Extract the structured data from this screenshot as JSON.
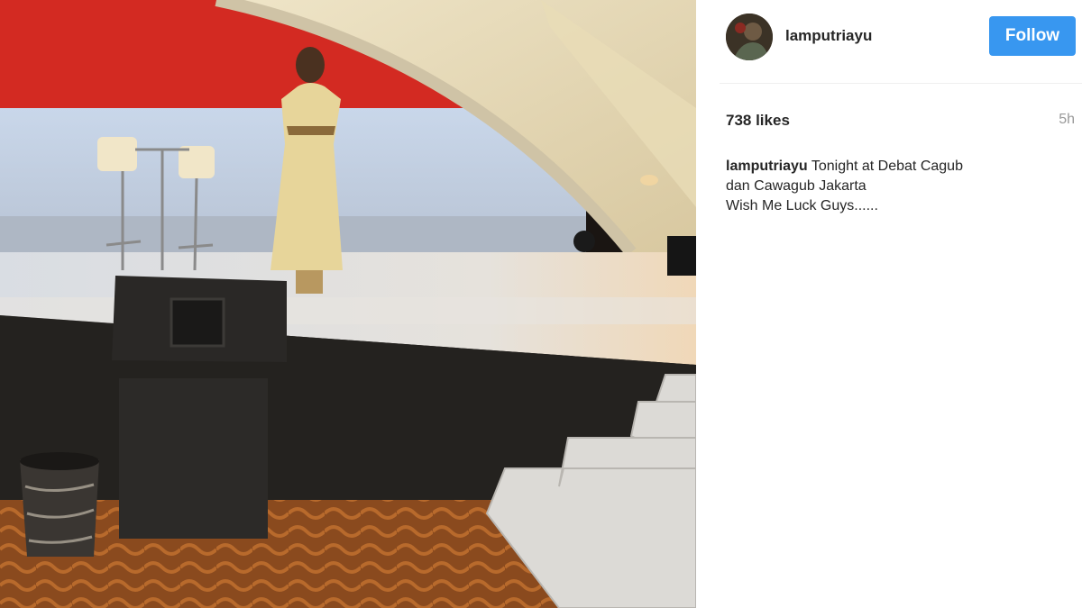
{
  "post": {
    "photo_icon": "stage-photo",
    "avatar_icon": "profile-avatar"
  },
  "header": {
    "username": "lamputriayu",
    "follow_label": "Follow",
    "follow_color": "#3897f0"
  },
  "stats": {
    "likes": "738 likes",
    "time": "5h"
  },
  "caption": {
    "username": "lamputriayu",
    "line1": "Tonight at Debat Cagub",
    "line2": "dan Cawagub Jakarta",
    "line3": "Wish Me Luck Guys......"
  }
}
